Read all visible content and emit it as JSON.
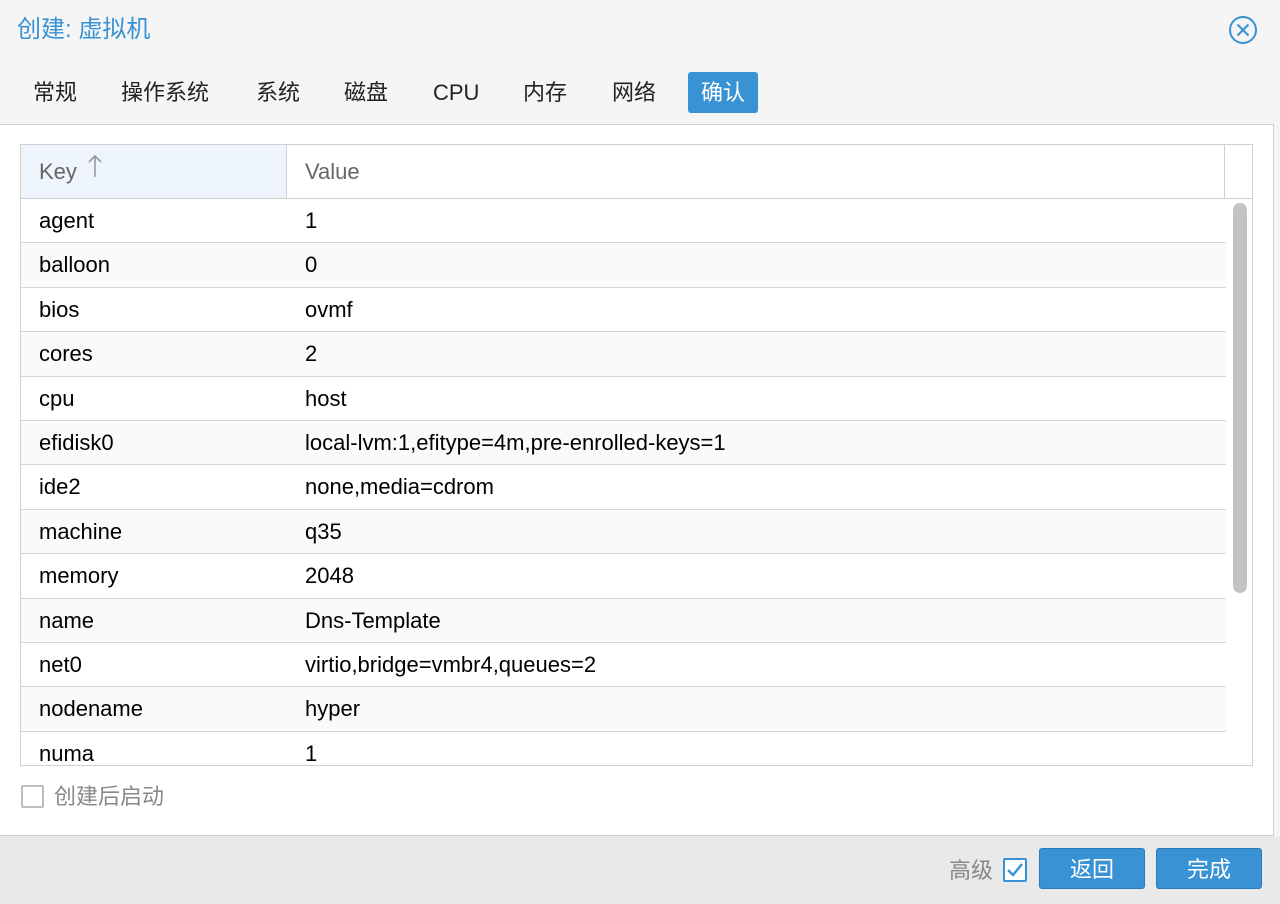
{
  "dialog": {
    "title": "创建: 虚拟机"
  },
  "tabs": [
    {
      "label": "常规"
    },
    {
      "label": "操作系统"
    },
    {
      "label": "系统"
    },
    {
      "label": "磁盘"
    },
    {
      "label": "CPU"
    },
    {
      "label": "内存"
    },
    {
      "label": "网络"
    },
    {
      "label": "确认",
      "active": true
    }
  ],
  "grid": {
    "columns": {
      "key": "Key",
      "value": "Value"
    },
    "sort": "ascending",
    "rows": [
      {
        "key": "agent",
        "value": "1"
      },
      {
        "key": "balloon",
        "value": "0"
      },
      {
        "key": "bios",
        "value": "ovmf"
      },
      {
        "key": "cores",
        "value": "2"
      },
      {
        "key": "cpu",
        "value": "host"
      },
      {
        "key": "efidisk0",
        "value": "local-lvm:1,efitype=4m,pre-enrolled-keys=1"
      },
      {
        "key": "ide2",
        "value": "none,media=cdrom"
      },
      {
        "key": "machine",
        "value": "q35"
      },
      {
        "key": "memory",
        "value": "2048"
      },
      {
        "key": "name",
        "value": "Dns-Template"
      },
      {
        "key": "net0",
        "value": "virtio,bridge=vmbr4,queues=2"
      },
      {
        "key": "nodename",
        "value": "hyper"
      },
      {
        "key": "numa",
        "value": "1"
      }
    ]
  },
  "start_after_create": {
    "label": "创建后启动",
    "checked": false
  },
  "footer": {
    "advanced_label": "高级",
    "advanced_checked": true,
    "back_label": "返回",
    "finish_label": "完成"
  },
  "colors": {
    "accent": "#3892d4",
    "header_key_bg": "#eef4fb"
  }
}
